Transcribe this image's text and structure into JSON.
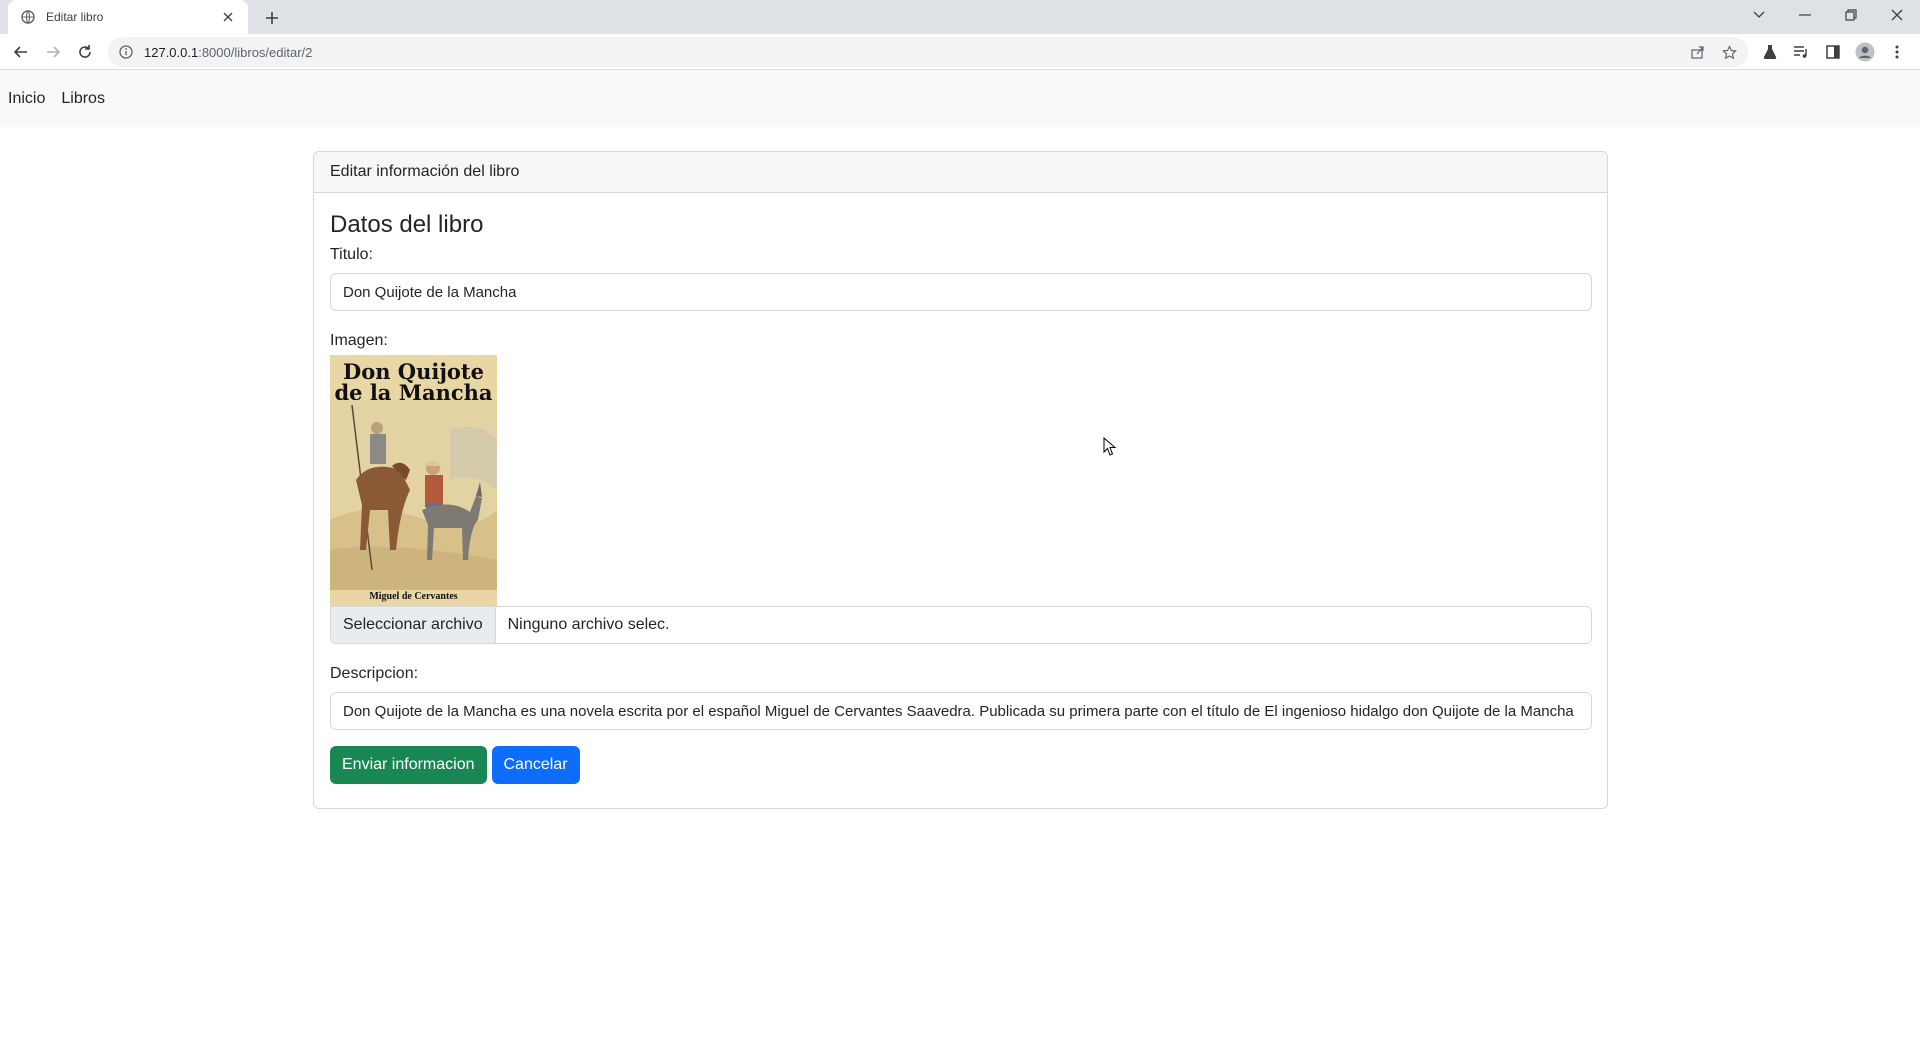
{
  "browser": {
    "tab_title": "Editar libro",
    "url_host": "127.0.0.1",
    "url_path": ":8000/libros/editar/2"
  },
  "navbar": {
    "items": [
      {
        "label": "Inicio"
      },
      {
        "label": "Libros"
      }
    ]
  },
  "card": {
    "header": "Editar información del libro",
    "heading": "Datos del libro",
    "fields": {
      "titulo_label": "Titulo:",
      "titulo_value": "Don Quijote de la Mancha",
      "imagen_label": "Imagen:",
      "file_button": "Seleccionar archivo",
      "file_status": "Ninguno archivo selec.",
      "descripcion_label": "Descripcion:",
      "descripcion_value": "Don Quijote de la Mancha es una novela escrita por el español Miguel de Cervantes Saavedra. Publicada su primera parte con el título de El ingenioso hidalgo don Quijote de la Mancha"
    },
    "cover": {
      "title_line1": "Don Quijote",
      "title_line2": "de la Mancha",
      "author": "Miguel de Cervantes"
    },
    "buttons": {
      "submit": "Enviar informacion",
      "cancel": "Cancelar"
    }
  },
  "colors": {
    "success": "#198754",
    "primary": "#0d6efd",
    "navbar_bg": "#f8f9fa"
  },
  "icons": [
    "globe-icon",
    "close-icon",
    "plus-icon",
    "back-icon",
    "forward-icon",
    "reload-icon",
    "info-icon",
    "share-icon",
    "star-icon",
    "extension-icon",
    "media-icon",
    "sidepanel-icon",
    "profile-icon",
    "menu-icon",
    "chevron-down-icon",
    "minimize-icon",
    "restore-icon",
    "window-close-icon"
  ]
}
